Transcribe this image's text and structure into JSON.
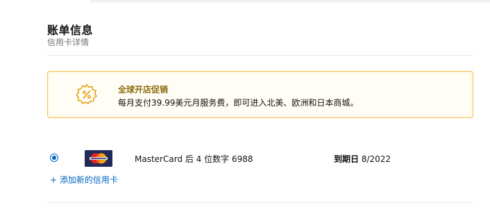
{
  "billing": {
    "title": "账单信息",
    "subtitle": "信用卡详情"
  },
  "promo": {
    "icon": "discount-badge-icon",
    "title": "全球开店促销",
    "text": "每月支付39.99美元月服务费，即可进入北美、欧洲和日本商城。",
    "accent_color": "#f0c14b"
  },
  "card": {
    "selected": true,
    "brand_icon": "mastercard-icon",
    "description": "MasterCard 后 4 位数字 6988",
    "expiry_label": "到期日",
    "expiry_value": "8/2022"
  },
  "actions": {
    "add_card": "+ 添加新的信用卡"
  },
  "colors": {
    "link": "#0066c0",
    "promo_title": "#8a6a0a"
  }
}
